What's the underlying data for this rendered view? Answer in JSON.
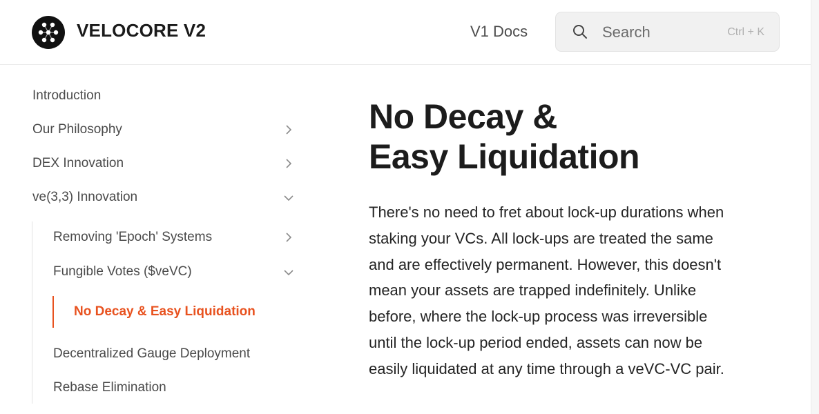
{
  "header": {
    "brand": "VELOCORE V2",
    "links": {
      "v1_docs": "V1 Docs"
    },
    "search": {
      "placeholder": "Search",
      "shortcut": "Ctrl + K"
    },
    "icons": {
      "logo": "velocore-logo-icon",
      "search": "search-icon"
    }
  },
  "sidebar": {
    "items": [
      {
        "label": "Introduction"
      },
      {
        "label": "Our Philosophy",
        "chevron": "chevron-right-icon"
      },
      {
        "label": "DEX Innovation",
        "chevron": "chevron-right-icon"
      },
      {
        "label": "ve(3,3) Innovation",
        "chevron": "chevron-down-icon"
      },
      {
        "label": "Removing 'Epoch' Systems",
        "chevron": "chevron-right-icon"
      },
      {
        "label": "Fungible Votes ($veVC)",
        "chevron": "chevron-down-icon"
      },
      {
        "label": "No Decay & Easy Liquidation",
        "active": true
      },
      {
        "label": "Decentralized Gauge Deployment"
      },
      {
        "label": "Rebase Elimination"
      }
    ],
    "active_color": "#e8521f"
  },
  "main": {
    "title_line1": "No Decay &",
    "title_line2": "Easy Liquidation",
    "body": "There's no need to fret about lock-up durations when staking your VCs. All lock-ups are treated the same and are effectively permanent. However, this doesn't mean your assets are trapped indefinitely. Unlike before, where the lock-up process was irreversible until the lock-up period ended, assets can now be easily liquidated at any time through a veVC-VC pair."
  }
}
